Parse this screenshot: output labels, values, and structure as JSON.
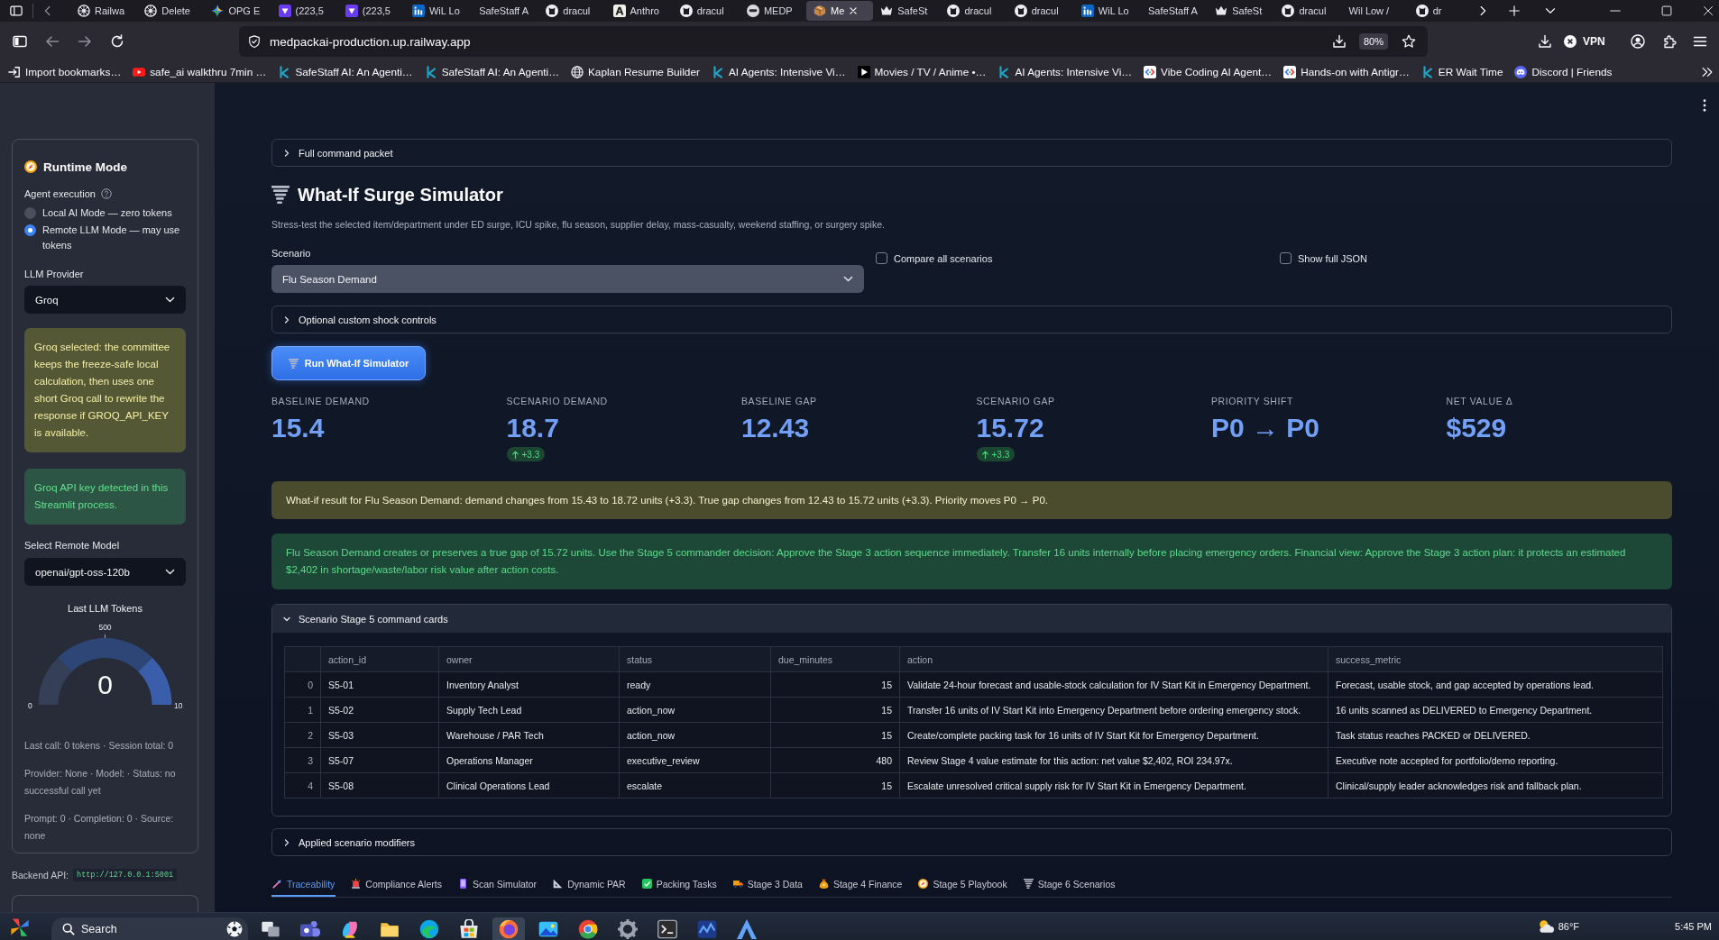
{
  "browser": {
    "tabs": [
      {
        "title": "Railwa",
        "kind": "wheel",
        "selected": false
      },
      {
        "title": "Delete",
        "kind": "wheel",
        "selected": false
      },
      {
        "title": "OPG E",
        "kind": "spark",
        "selected": false
      },
      {
        "title": "(223,5",
        "kind": "tile",
        "selected": false
      },
      {
        "title": "(223,5",
        "kind": "tile",
        "selected": false
      },
      {
        "title": "WiL Lo",
        "kind": "bars",
        "selected": false
      },
      {
        "title": "SafeStaff A",
        "kind": "plain",
        "selected": false
      },
      {
        "title": "dracul",
        "kind": "cat",
        "selected": false
      },
      {
        "title": "Anthro",
        "kind": "letter",
        "selected": false
      },
      {
        "title": "dracul",
        "kind": "cat",
        "selected": false
      },
      {
        "title": "MEDP",
        "kind": "mask",
        "selected": false
      },
      {
        "title": "Me",
        "kind": "box",
        "selected": true
      },
      {
        "title": "SafeSt",
        "kind": "crown",
        "selected": false
      },
      {
        "title": "dracul",
        "kind": "cat",
        "selected": false
      },
      {
        "title": "dracul",
        "kind": "cat",
        "selected": false
      },
      {
        "title": "WiL Lo",
        "kind": "bars",
        "selected": false
      },
      {
        "title": "SafeStaff A",
        "kind": "plain",
        "selected": false
      },
      {
        "title": "SafeSt",
        "kind": "crown",
        "selected": false
      },
      {
        "title": "dracul",
        "kind": "cat",
        "selected": false
      },
      {
        "title": "Wil Low /",
        "kind": "plain",
        "selected": false
      },
      {
        "title": "dr",
        "kind": "cat",
        "selected": false
      }
    ],
    "address": "medpackai-production.up.railway.app",
    "zoom": "80%",
    "vpn": "VPN",
    "bookmarks": [
      {
        "label": "Import bookmarks…",
        "kind": "import"
      },
      {
        "label": "safe_ai walkthru 7min …",
        "kind": "video"
      },
      {
        "label": "SafeStaff AI: An Agenti…",
        "kind": "k"
      },
      {
        "label": "SafeStaff AI: An Agenti…",
        "kind": "k"
      },
      {
        "label": "Kaplan Resume Builder",
        "kind": "globe"
      },
      {
        "label": "AI Agents: Intensive Vi…",
        "kind": "k"
      },
      {
        "label": "Movies / TV / Anime •…",
        "kind": "play"
      },
      {
        "label": "AI Agents: Intensive Vi…",
        "kind": "k"
      },
      {
        "label": "Vibe Coding AI Agent…",
        "kind": "code"
      },
      {
        "label": "Hands-on with Antigr…",
        "kind": "code"
      },
      {
        "label": "ER Wait Time",
        "kind": "k"
      },
      {
        "label": "Discord | Friends",
        "kind": "chat"
      }
    ]
  },
  "sidebar": {
    "title": "Runtime Mode",
    "agent_execution": {
      "label": "Agent execution",
      "options": [
        {
          "label": "Local AI Mode — zero tokens",
          "selected": false
        },
        {
          "label": "Remote LLM Mode — may use tokens",
          "selected": true
        }
      ]
    },
    "provider": {
      "label": "LLM Provider",
      "value": "Groq"
    },
    "notices": [
      {
        "kind": "warning",
        "text": "Groq selected: the committee keeps the freeze-safe local calculation, then uses one short Groq call to rewrite the response if GROQ_API_KEY is available."
      },
      {
        "kind": "success",
        "text": "Groq API key detected in this Streamlit process."
      }
    ],
    "model": {
      "label": "Select Remote Model",
      "value": "openai/gpt-oss-120b"
    },
    "gauge": {
      "title": "Last LLM Tokens",
      "value": "0",
      "min": "0",
      "mid": "500",
      "max": "10"
    },
    "stats": [
      "Last call: 0 tokens · Session total: 0",
      "Provider: None · Model: · Status: no successful call yet",
      "Prompt: 0 · Completion: 0 · Source: none"
    ],
    "backend": {
      "label": "Backend API:",
      "value": "http://127.0.0.1:5001"
    }
  },
  "main": {
    "top_expander": {
      "label": "Full command packet",
      "expanded": false
    },
    "title": "What-If Surge Simulator",
    "caption": "Stress-test the selected item/department under ED surge, ICU spike, flu season, supplier delay, mass-casualty, weekend staffing, or surgery spike.",
    "scenario": {
      "label": "Scenario",
      "value": "Flu Season Demand"
    },
    "options": [
      {
        "label": "Compare all scenarios",
        "checked": false
      },
      {
        "label": "Show full JSON",
        "checked": false
      }
    ],
    "custom_controls": {
      "label": "Optional custom shock controls",
      "expanded": false
    },
    "run_button": "Run What-If Simulator",
    "metrics": [
      {
        "label": "BASELINE DEMAND",
        "value": "15.4",
        "kind": "plain"
      },
      {
        "label": "SCENARIO DEMAND",
        "value": "18.7",
        "kind": "rise",
        "delta": "+3.3"
      },
      {
        "label": "BASELINE GAP",
        "value": "12.43",
        "kind": "plain"
      },
      {
        "label": "SCENARIO GAP",
        "value": "15.72",
        "kind": "rise",
        "delta": "+3.3"
      },
      {
        "label": "PRIORITY SHIFT",
        "value": "P0 → P0",
        "kind": "plain"
      },
      {
        "label": "NET VALUE Δ",
        "value": "$529",
        "kind": "plain"
      }
    ],
    "alerts": [
      {
        "kind": "warning",
        "text": "What-if result for Flu Season Demand: demand changes from 15.43 to 18.72 units (+3.3). True gap changes from 12.43 to 15.72 units (+3.3). Priority moves P0 → P0."
      },
      {
        "kind": "success",
        "text": "Flu Season Demand creates or preserves a true gap of 15.72 units. Use the Stage 5 commander decision: Approve the Stage 3 action sequence immediately. Transfer 16 units internally before placing emergency orders. Financial view: Approve the Stage 3 action plan: it protects an estimated $2,402 in shortage/waste/labor risk value after action costs."
      }
    ],
    "command_cards": {
      "label": "Scenario Stage 5 command cards",
      "expanded": true,
      "table": {
        "columns": [
          "action_id",
          "owner",
          "status",
          "due_minutes",
          "action",
          "success_metric"
        ],
        "rows": [
          {
            "index": "0",
            "cells": [
              "S5-01",
              "Inventory Analyst",
              "ready",
              "15",
              "Validate 24-hour forecast and usable-stock calculation for IV Start Kit in Emergency Department.",
              "Forecast, usable stock, and gap accepted by operations lead."
            ]
          },
          {
            "index": "1",
            "cells": [
              "S5-02",
              "Supply Tech Lead",
              "action_now",
              "15",
              "Transfer 16 units of IV Start Kit into Emergency Department before ordering emergency stock.",
              "16 units scanned as DELIVERED to Emergency Department."
            ]
          },
          {
            "index": "2",
            "cells": [
              "S5-03",
              "Warehouse / PAR Tech",
              "action_now",
              "15",
              "Create/complete packing task for 16 units of IV Start Kit for Emergency Department.",
              "Task status reaches PACKED or DELIVERED."
            ]
          },
          {
            "index": "3",
            "cells": [
              "S5-07",
              "Operations Manager",
              "executive_review",
              "480",
              "Review Stage 4 value estimate for this action: net value $2,402, ROI 234.97x.",
              "Executive note accepted for portfolio/demo reporting."
            ]
          },
          {
            "index": "4",
            "cells": [
              "S5-08",
              "Clinical Operations Lead",
              "escalate",
              "15",
              "Escalate unresolved critical supply risk for IV Start Kit in Emergency Department.",
              "Clinical/supply leader acknowledges risk and fallback plan."
            ]
          }
        ]
      }
    },
    "modifiers": {
      "label": "Applied scenario modifiers",
      "expanded": false
    },
    "tabs": [
      {
        "label": "Traceability",
        "kind": "link",
        "selected": true
      },
      {
        "label": "Compliance Alerts",
        "kind": "siren",
        "selected": false
      },
      {
        "label": "Scan Simulator",
        "kind": "phone",
        "selected": false
      },
      {
        "label": "Dynamic PAR",
        "kind": "ruler",
        "selected": false
      },
      {
        "label": "Packing Tasks",
        "kind": "check",
        "selected": false
      },
      {
        "label": "Stage 3 Data",
        "kind": "truck",
        "selected": false
      },
      {
        "label": "Stage 4 Finance",
        "kind": "bag",
        "selected": false
      },
      {
        "label": "Stage 5 Playbook",
        "kind": "compass",
        "selected": false
      },
      {
        "label": "Stage 6 Scenarios",
        "kind": "tornado",
        "selected": false
      }
    ]
  },
  "taskbar": {
    "search": {
      "placeholder": "Search"
    },
    "apps": [
      {
        "kind": "taskview",
        "selected": false
      },
      {
        "kind": "people",
        "selected": false
      },
      {
        "kind": "sparkle",
        "selected": false
      },
      {
        "kind": "folder",
        "selected": false
      },
      {
        "kind": "wave",
        "selected": false
      },
      {
        "kind": "store",
        "selected": false
      },
      {
        "kind": "browser",
        "selected": true
      },
      {
        "kind": "photo",
        "selected": false
      },
      {
        "kind": "segments",
        "selected": false
      },
      {
        "kind": "gear",
        "selected": false
      },
      {
        "kind": "terminal",
        "selected": false
      },
      {
        "kind": "chart",
        "selected": false
      },
      {
        "kind": "arrowhead",
        "selected": false
      }
    ],
    "weather": "86°F",
    "clock": "5:45 PM"
  }
}
